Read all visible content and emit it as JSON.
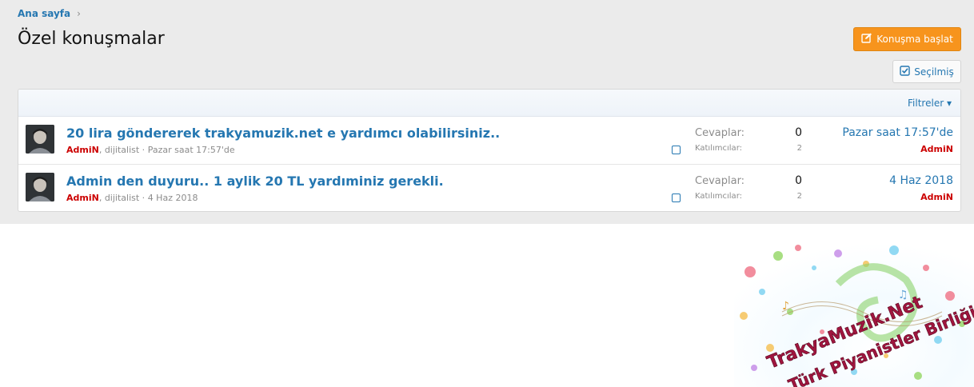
{
  "breadcrumb": {
    "home": "Ana sayfa",
    "separator": "›"
  },
  "page_title": "Özel konuşmalar",
  "buttons": {
    "start_conversation": "Konuşma başlat",
    "selected": "Seçilmiş"
  },
  "filter": {
    "label": "Filtreler",
    "caret": "▾"
  },
  "stats_labels": {
    "replies": "Cevaplar:",
    "participants": "Katılımcılar:"
  },
  "conversations": [
    {
      "title": "20 lira göndererek trakyamuzik.net e yardımcı olabilirsiniz..",
      "author": "AdmiN",
      "participants_text": ", dijitalist",
      "date": "Pazar saat 17:57'de",
      "meta_sep": " · ",
      "replies": "0",
      "participants": "2",
      "last_date": "Pazar saat 17:57'de",
      "last_user": "AdmiN"
    },
    {
      "title": "Admin den duyuru.. 1 aylik 20 TL yardıminiz gerekli.",
      "author": "AdmiN",
      "participants_text": ", dijitalist",
      "date": "4 Haz 2018",
      "meta_sep": " · ",
      "replies": "0",
      "participants": "2",
      "last_date": "4 Haz 2018",
      "last_user": "AdmiN"
    }
  ],
  "banner": {
    "line1": "TrakyaMuzik.Net",
    "line2": "Türk Piyanistler Birliği"
  },
  "colors": {
    "link": "#2577b1",
    "username": "#cc0000",
    "primary_button": "#f7941d",
    "background": "#ebebeb"
  }
}
